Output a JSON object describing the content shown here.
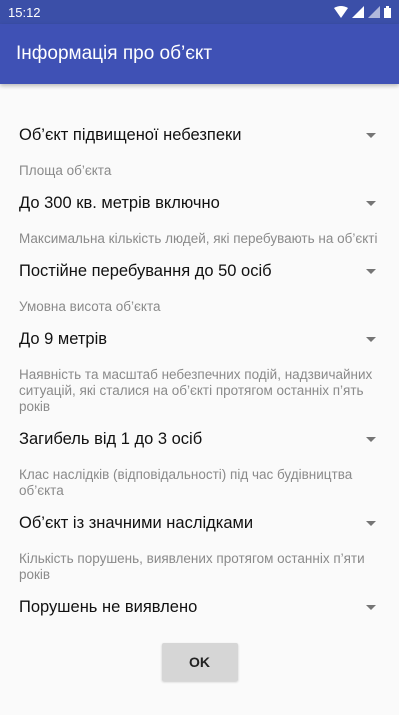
{
  "status_bar": {
    "time": "15:12",
    "icons": [
      "wifi-icon",
      "signal-icon",
      "signal-icon",
      "battery-icon"
    ]
  },
  "app_bar": {
    "title": "Інформація про об’єкт"
  },
  "form": {
    "object_type": {
      "value": "Об’єкт підвищеної небезпеки"
    },
    "area": {
      "label": "Площа об’єкта",
      "value": "До 300 кв. метрів включно"
    },
    "people": {
      "label": "Максимальна кількість людей, які перебувають на об’єкті",
      "value": "Постійне перебування до 50 осіб"
    },
    "height": {
      "label": "Умовна висота об’єкта",
      "value": "До 9 метрів"
    },
    "incidents": {
      "label": "Наявність та масштаб небезпечних подій, надзвичайних ситуацій, які сталися на об’єкті протягом останніх п’ять років",
      "value": "Загибель від 1 до 3 осіб"
    },
    "consequences": {
      "label": "Клас наслідків (відповідальності) під час будівництва об’єкта",
      "value": "Об’єкт із значними наслідками"
    },
    "violations": {
      "label": "Кількість порушень, виявлених протягом останніх п’яти років",
      "value": "Порушень не виявлено"
    }
  },
  "ok_button": {
    "label": "OK"
  },
  "colors": {
    "primary": "#3f51b5",
    "primary_dark": "#3b4fa8",
    "background": "#fafafa"
  }
}
